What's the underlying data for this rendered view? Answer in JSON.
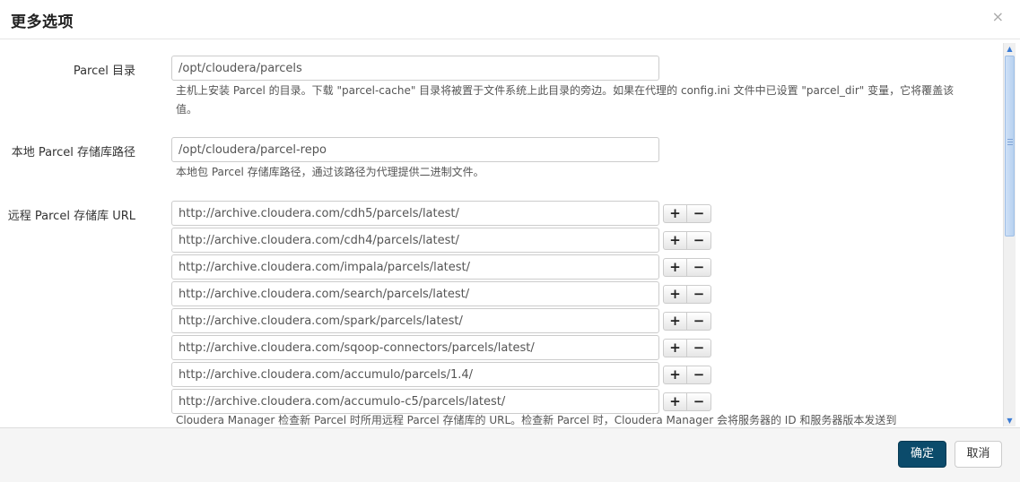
{
  "dialog": {
    "title": "更多选项",
    "close_glyph": "×"
  },
  "parcel_dir": {
    "label": "Parcel 目录",
    "value": "/opt/cloudera/parcels",
    "help": "主机上安装 Parcel 的目录。下载 \"parcel-cache\" 目录将被置于文件系统上此目录的旁边。如果在代理的 config.ini 文件中已设置 \"parcel_dir\" 变量，它将覆盖该值。"
  },
  "local_repo": {
    "label": "本地 Parcel 存储库路径",
    "value": "/opt/cloudera/parcel-repo",
    "help": "本地包 Parcel 存储库路径，通过该路径为代理提供二进制文件。"
  },
  "remote_repo": {
    "label": "远程 Parcel 存储库 URL",
    "urls": [
      "http://archive.cloudera.com/cdh5/parcels/latest/",
      "http://archive.cloudera.com/cdh4/parcels/latest/",
      "http://archive.cloudera.com/impala/parcels/latest/",
      "http://archive.cloudera.com/search/parcels/latest/",
      "http://archive.cloudera.com/spark/parcels/latest/",
      "http://archive.cloudera.com/sqoop-connectors/parcels/latest/",
      "http://archive.cloudera.com/accumulo/parcels/1.4/",
      "http://archive.cloudera.com/accumulo-c5/parcels/latest/"
    ],
    "plus_glyph": "+",
    "minus_glyph": "−",
    "help": "Cloudera Manager 检查新 Parcel 时所用远程 Parcel 存储库的 URL。检查新 Parcel 时，Cloudera Manager 会将服务器的 ID 和服务器版本发送到"
  },
  "footer": {
    "ok_label": "确定",
    "cancel_label": "取消"
  },
  "scrollbar": {
    "up_glyph": "▲",
    "down_glyph": "▼"
  }
}
